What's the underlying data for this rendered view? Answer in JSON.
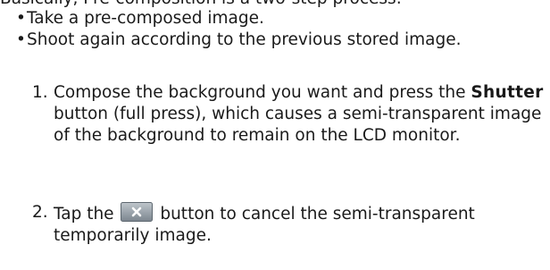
{
  "intro_cut_text": "Basically, Pre-composition is a two-step process:",
  "bullets": [
    "Take a pre-composed image.",
    "Shoot again according to the previous stored image."
  ],
  "bullet_marker": "•",
  "steps": [
    {
      "number": "1.",
      "text_before": "Compose the background you want and press the",
      "bold_term": "Shutter",
      "text_after": "button (full press), which causes a semi-transparent image of the background to remain on the LCD monitor."
    },
    {
      "number": "2.",
      "text_before": "Tap the",
      "icon_name": "close-x-icon",
      "text_after": "button to cancel the semi-transparent temporarily image."
    }
  ],
  "colors": {
    "text": "#1a1a1a",
    "icon_top": "#bfc6cc",
    "icon_bottom": "#7b858e",
    "icon_border": "#5e6870"
  }
}
